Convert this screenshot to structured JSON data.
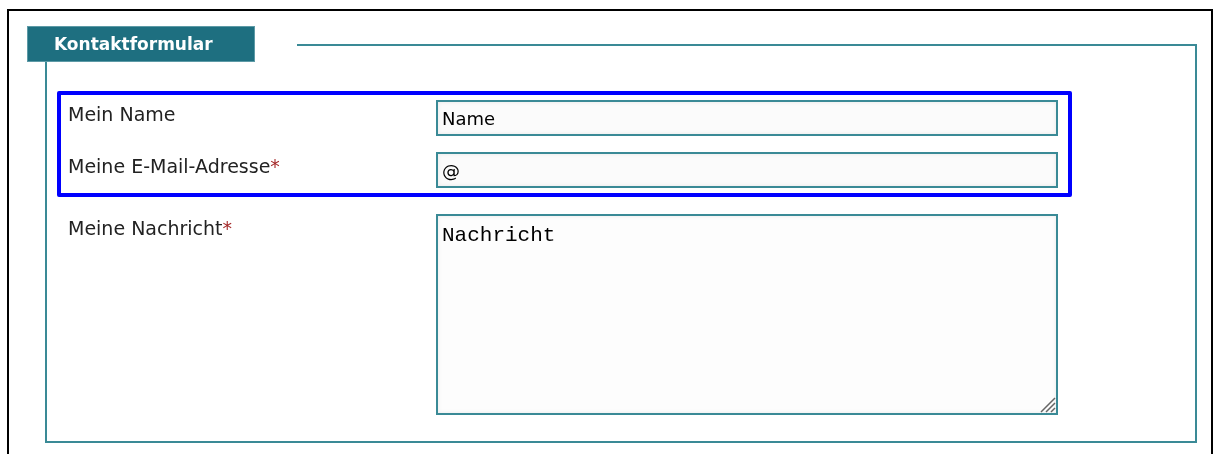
{
  "form": {
    "legend": "Kontaktformular",
    "fields": [
      {
        "label": "Mein Name",
        "kind": "text",
        "value": "Name",
        "highlighted": true
      },
      {
        "label": "Meine E-Mail-Adresse",
        "required_mark": "*",
        "kind": "text",
        "value": "@",
        "highlighted": true
      },
      {
        "label": "Meine Nachricht",
        "required_mark": "*",
        "kind": "textarea",
        "value": "Nachricht",
        "highlighted": false
      }
    ]
  }
}
